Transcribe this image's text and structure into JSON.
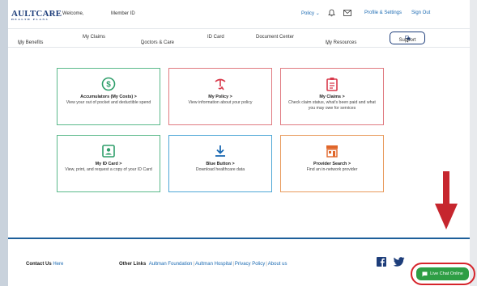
{
  "header": {
    "logo_text": "AULTCARE",
    "logo_sub": "HEALTH PLANS",
    "welcome": "Welcome,",
    "member_id": "Member ID",
    "policy": "Policy",
    "profile": "Profile & Settings",
    "signout": "Sign Out"
  },
  "nav": {
    "my_benefits": "My Benefits",
    "my_claims": "My Claims",
    "doctors_care": "Doctors & Care",
    "id_card": "ID Card",
    "document_center": "Document Center",
    "my_resources": "My Resources",
    "support": "Support"
  },
  "tiles": [
    {
      "title": "Accumulators (My Costs) >",
      "desc": "View your out of pocket and deductible spend",
      "color": "#2e9e6a",
      "icon": "dollar-icon"
    },
    {
      "title": "My Policy >",
      "desc": "View information about your policy",
      "color": "#d8384a",
      "icon": "policy-icon"
    },
    {
      "title": "My Claims >",
      "desc": "Check claim status, what's been paid and what you may owe for services",
      "color": "#d8384a",
      "icon": "clipboard-icon"
    },
    {
      "title": "My ID Card >",
      "desc": "View, print, and request a copy of your ID Card",
      "color": "#2e9e6a",
      "icon": "id-card-icon"
    },
    {
      "title": "Blue Button >",
      "desc": "Download healthcare data",
      "color": "#1b6ab2",
      "icon": "download-icon"
    },
    {
      "title": "Provider Search >",
      "desc": "Find an in-network provider",
      "color": "#e0662a",
      "icon": "building-icon"
    }
  ],
  "footer": {
    "contact_label": "Contact Us",
    "contact_link": "Here",
    "other_links_label": "Other Links",
    "links": [
      "Aultman Foundation",
      "Aultman Hospital",
      "Privacy Policy",
      "About us"
    ]
  },
  "chat": {
    "label": "Live Chat Online"
  }
}
